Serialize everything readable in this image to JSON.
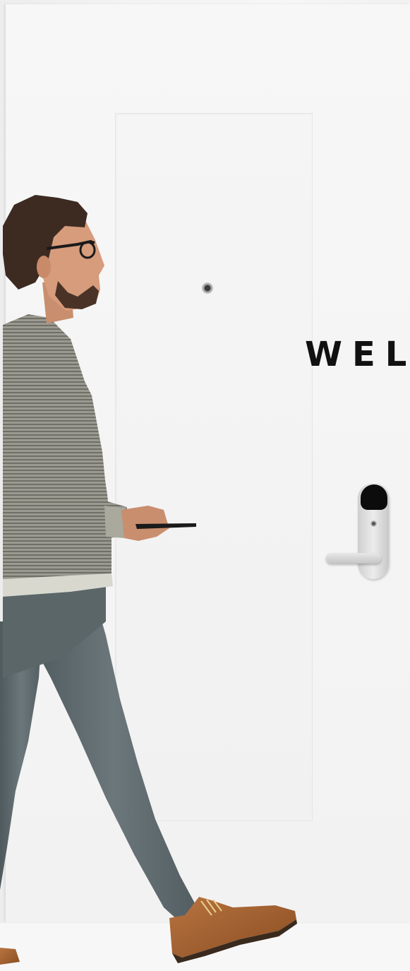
{
  "hero": {
    "heading": "WELC"
  },
  "colors": {
    "door": "#f4f4f4",
    "heading_text": "#111111",
    "lock_reader": "#0c0c0c",
    "sweater": "#8c8c82",
    "jeans": "#5f6a6e",
    "boots": "#a4622f"
  },
  "icons": {
    "peephole": "peephole-icon",
    "smart_lock": "smart-lock-icon",
    "smartphone": "smartphone-icon"
  }
}
